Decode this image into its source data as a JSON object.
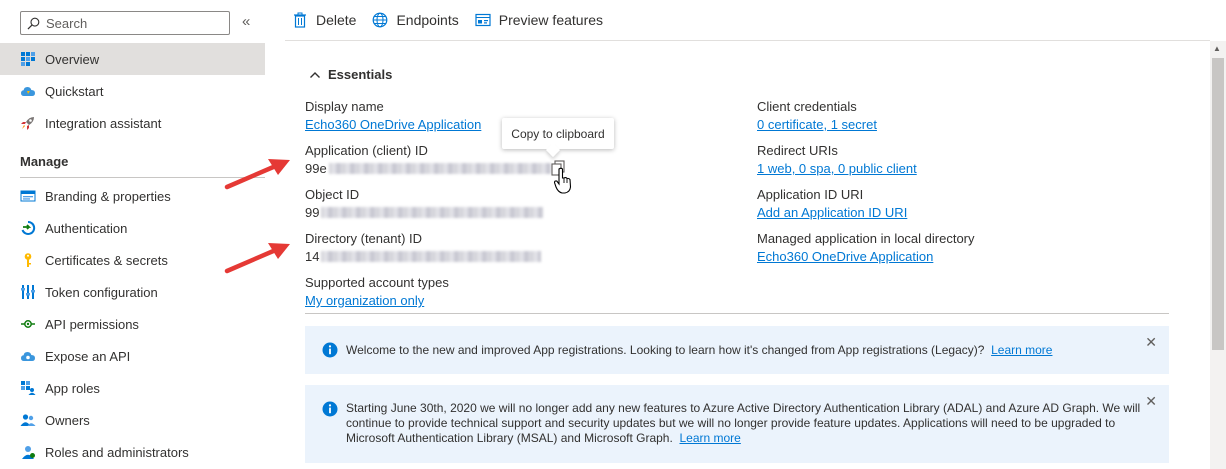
{
  "sidebar": {
    "search_placeholder": "Search",
    "collapse_glyph": "«",
    "top_items": [
      {
        "label": "Overview",
        "icon": "overview-grid-icon"
      },
      {
        "label": "Quickstart",
        "icon": "cloud-icon"
      },
      {
        "label": "Integration assistant",
        "icon": "rocket-icon"
      }
    ],
    "section_label": "Manage",
    "manage_items": [
      {
        "label": "Branding & properties",
        "icon": "branding-icon"
      },
      {
        "label": "Authentication",
        "icon": "authentication-icon"
      },
      {
        "label": "Certificates & secrets",
        "icon": "key-icon"
      },
      {
        "label": "Token configuration",
        "icon": "token-bars-icon"
      },
      {
        "label": "API permissions",
        "icon": "api-permissions-icon"
      },
      {
        "label": "Expose an API",
        "icon": "cloud-expose-icon"
      },
      {
        "label": "App roles",
        "icon": "app-roles-icon"
      },
      {
        "label": "Owners",
        "icon": "owners-icon"
      },
      {
        "label": "Roles and administrators",
        "icon": "roles-admins-icon"
      }
    ]
  },
  "toolbar": {
    "delete_label": "Delete",
    "endpoints_label": "Endpoints",
    "preview_label": "Preview features"
  },
  "essentials": {
    "title": "Essentials",
    "left": {
      "display_name_label": "Display name",
      "display_name_value": "Echo360 OneDrive Application",
      "app_id_label": "Application (client) ID",
      "app_id_prefix": "99e",
      "object_id_label": "Object ID",
      "object_id_prefix": "99",
      "tenant_id_label": "Directory (tenant) ID",
      "tenant_id_prefix": "14",
      "account_types_label": "Supported account types",
      "account_types_value": "My organization only"
    },
    "right": {
      "client_credentials_label": "Client credentials",
      "client_credentials_value": "0 certificate, 1 secret",
      "redirect_uris_label": "Redirect URIs",
      "redirect_uris_value": "1 web, 0 spa, 0 public client",
      "app_id_uri_label": "Application ID URI",
      "app_id_uri_value": "Add an Application ID URI",
      "managed_app_label": "Managed application in local directory",
      "managed_app_value": "Echo360 OneDrive Application"
    },
    "tooltip": "Copy to clipboard"
  },
  "banners": [
    {
      "text": "Welcome to the new and improved App registrations. Looking to learn how it's changed from App registrations (Legacy)?",
      "link": "Learn more"
    },
    {
      "text": "Starting June 30th, 2020 we will no longer add any new features to Azure Active Directory Authentication Library (ADAL) and Azure AD Graph. We will continue to provide technical support and security updates but we will no longer provide feature updates. Applications will need to be upgraded to Microsoft Authentication Library (MSAL) and Microsoft Graph.",
      "link": "Learn more"
    }
  ],
  "colors": {
    "accent": "#0078d4",
    "banner_bg": "#ebf3fc",
    "annotation_arrow": "#e53935",
    "nav_active_bg": "#e1dfdd"
  }
}
